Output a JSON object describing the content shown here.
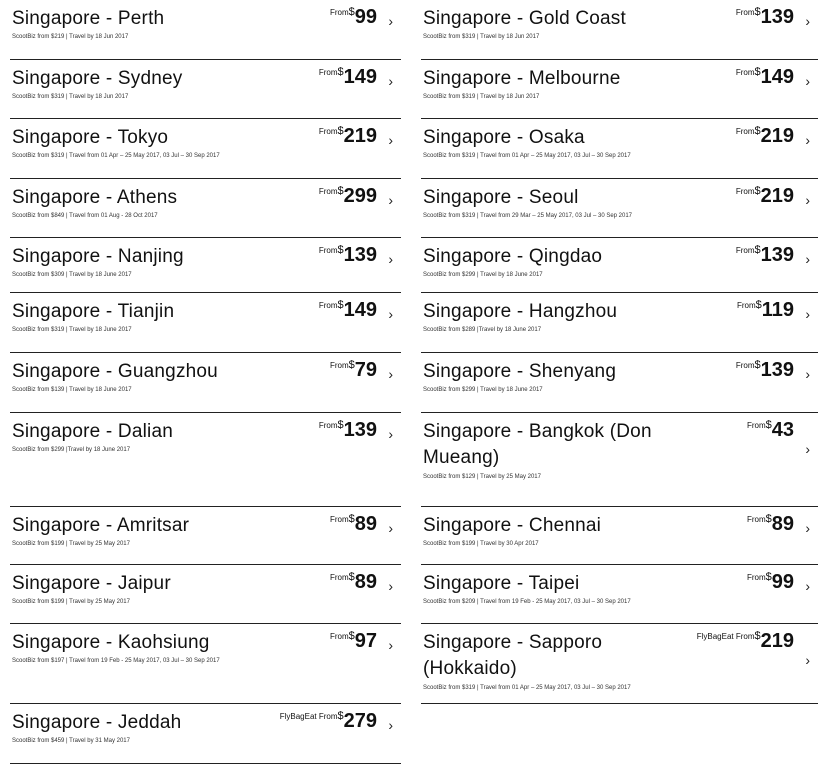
{
  "price_prefix": "From",
  "currency": "$",
  "chevron": "›",
  "routes": [
    {
      "title": "Singapore - Perth",
      "sub": "ScootBiz from $219 | Travel by 18 Jun 2017",
      "prefix": "From",
      "price": "99"
    },
    {
      "title": "Singapore - Gold Coast",
      "sub": "ScootBiz from $319 | Travel by 18 Jun 2017",
      "prefix": "From",
      "price": "139"
    },
    {
      "title": "Singapore - Sydney",
      "sub": "ScootBiz from $319 | Travel by 18 Jun 2017",
      "prefix": "From",
      "price": "149"
    },
    {
      "title": "Singapore - Melbourne",
      "sub": "ScootBiz from $319 | Travel by 18 Jun 2017",
      "prefix": "From",
      "price": "149"
    },
    {
      "title": "Singapore - Tokyo",
      "sub": "ScootBiz from $319 | Travel from 01 Apr – 25 May 2017, 03 Jul – 30 Sep 2017",
      "prefix": "From",
      "price": "219"
    },
    {
      "title": "Singapore - Osaka",
      "sub": "ScootBiz from $319 | Travel from 01 Apr – 25 May 2017, 03 Jul – 30 Sep 2017",
      "prefix": "From",
      "price": "219"
    },
    {
      "title": "Singapore - Athens",
      "sub": "ScootBiz from $849 | Travel from 01 Aug -  28 Oct 2017",
      "prefix": "From",
      "price": "299"
    },
    {
      "title": "Singapore - Seoul",
      "sub": "ScootBiz from $319 | Travel from 29 Mar – 25 May 2017, 03 Jul – 30 Sep 2017",
      "prefix": "From",
      "price": "219"
    },
    {
      "title": "Singapore - Nanjing",
      "sub": "ScootBiz from $309 | Travel by 18 June 2017",
      "prefix": "From",
      "price": "139"
    },
    {
      "title": "Singapore - Qingdao",
      "sub": "ScootBiz from $299 | Travel by 18 June 2017",
      "prefix": "From",
      "price": "139"
    },
    {
      "title": "Singapore - Tianjin",
      "sub": "ScootBiz from $319 | Travel by 18 June 2017",
      "prefix": "From",
      "price": "149"
    },
    {
      "title": "Singapore - Hangzhou",
      "sub": "ScootBiz from $289 |Travel by 18 June 2017",
      "prefix": "From",
      "price": "119"
    },
    {
      "title": "Singapore - Guangzhou",
      "sub": "ScootBiz from $139 | Travel by 18 June 2017",
      "prefix": "From",
      "price": "79"
    },
    {
      "title": "Singapore - Shenyang",
      "sub": "ScootBiz from $299 | Travel by 18 June 2017",
      "prefix": "From",
      "price": "139"
    },
    {
      "title": "Singapore - Dalian",
      "sub": "ScootBiz from $299 |Travel by 18 June 2017",
      "prefix": "From",
      "price": "139"
    },
    {
      "title": "Singapore - Bangkok (Don Mueang)",
      "sub": "ScootBiz from $129 | Travel by 25 May 2017",
      "prefix": "From",
      "price": "43"
    },
    {
      "title": "Singapore - Amritsar",
      "sub": "ScootBiz from $199 | Travel by 25 May 2017",
      "prefix": "From",
      "price": "89"
    },
    {
      "title": "Singapore - Chennai",
      "sub": "ScootBiz from $199 | Travel by 30 Apr 2017",
      "prefix": "From",
      "price": "89"
    },
    {
      "title": "Singapore - Jaipur",
      "sub": "ScootBiz from $199 | Travel by 25 May 2017",
      "prefix": "From",
      "price": "89"
    },
    {
      "title": "Singapore - Taipei",
      "sub": "ScootBiz from $209 | Travel from 19 Feb - 25 May 2017, 03 Jul – 30 Sep 2017",
      "prefix": "From",
      "price": "99"
    },
    {
      "title": "Singapore - Kaohsiung",
      "sub": "ScootBiz from $197 | Travel from 19 Feb - 25 May 2017, 03 Jul – 30 Sep 2017",
      "prefix": "From",
      "price": "97"
    },
    {
      "title": "Singapore - Sapporo (Hokkaido)",
      "sub": "ScootBiz from $319 | Travel from 01 Apr – 25 May 2017, 03 Jul – 30 Sep 2017",
      "prefix": "FlyBagEat From",
      "price": "219"
    },
    {
      "title": "Singapore - Jeddah",
      "sub": "ScootBiz from $459 | Travel by 31 May 2017",
      "prefix": "FlyBagEat From",
      "price": "279"
    }
  ]
}
